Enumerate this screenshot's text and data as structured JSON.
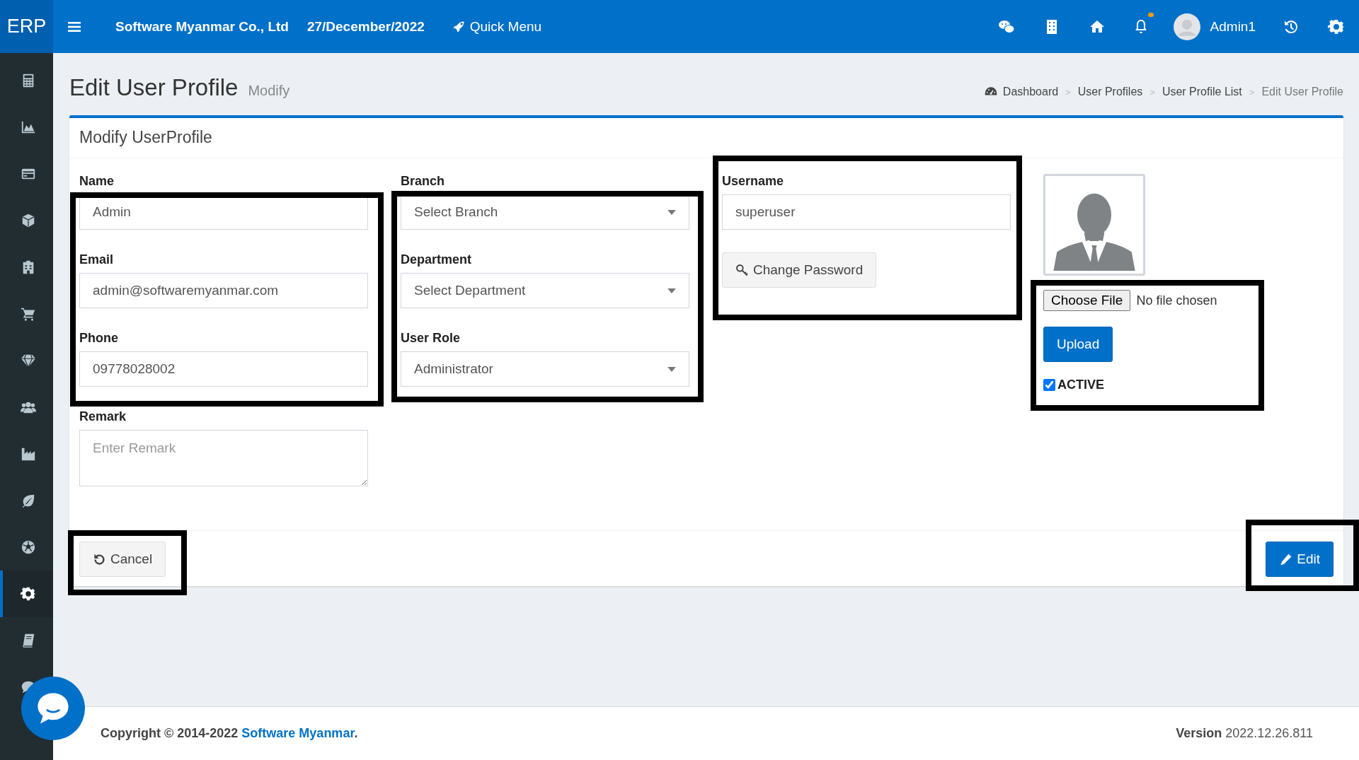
{
  "topbar": {
    "brand": "ERP",
    "company": "Software Myanmar Co., Ltd",
    "date": "27/December/2022",
    "quick_menu": "Quick Menu",
    "has_notification": true,
    "user": "Admin1"
  },
  "sidebar": {
    "items": [
      {
        "selected": false
      },
      {
        "selected": false
      },
      {
        "selected": false
      },
      {
        "selected": false
      },
      {
        "selected": false
      },
      {
        "selected": false
      },
      {
        "selected": false
      },
      {
        "selected": false
      },
      {
        "selected": false
      },
      {
        "selected": false
      },
      {
        "selected": false
      },
      {
        "selected": true
      },
      {
        "selected": false
      },
      {
        "selected": false
      }
    ]
  },
  "page": {
    "title": "Edit User Profile",
    "subtitle": "Modify",
    "breadcrumb_separator": ">",
    "breadcrumb": [
      {
        "label": "Dashboard",
        "current": false
      },
      {
        "label": "User Profiles",
        "current": false
      },
      {
        "label": "User Profile List",
        "current": false
      },
      {
        "label": "Edit User Profile",
        "current": true
      }
    ]
  },
  "card": {
    "title": "Modify UserProfile",
    "columns": [
      {
        "groups": [
          {
            "highlighted": true,
            "fields": [
              {
                "kind": "text",
                "label": "Name",
                "value": "Admin"
              },
              {
                "kind": "text",
                "label": "Email",
                "value": "admin@softwaremyanmar.com"
              },
              {
                "kind": "text",
                "label": "Phone",
                "value": "09778028002"
              }
            ]
          },
          {
            "highlighted": false,
            "fields": [
              {
                "kind": "textarea",
                "label": "Remark",
                "placeholder": "Enter Remark"
              }
            ]
          }
        ]
      },
      {
        "groups": [
          {
            "highlighted": true,
            "fields": [
              {
                "kind": "select",
                "label": "Branch",
                "value": "Select Branch"
              },
              {
                "kind": "select",
                "label": "Department",
                "value": "Select Department"
              },
              {
                "kind": "select",
                "label": "User Role",
                "value": "Administrator"
              }
            ]
          }
        ]
      },
      {
        "groups": [
          {
            "highlighted": true,
            "fields": [
              {
                "kind": "text",
                "label": "Username",
                "value": "superuser"
              },
              {
                "kind": "button",
                "label": "Change Password"
              }
            ]
          }
        ]
      }
    ],
    "photo": {
      "highlighted": true,
      "choose_file": "Choose File",
      "file_status": "No file chosen",
      "upload": "Upload",
      "active_label": "ACTIVE",
      "active": true
    },
    "actions": [
      {
        "kind": "cancel",
        "label": "Cancel",
        "highlighted": true
      },
      {
        "kind": "edit",
        "label": "Edit",
        "highlighted": true
      }
    ]
  },
  "footer": {
    "copyright": "Copyright © 2014-2022",
    "company_link": "Software Myanmar",
    "end": ".",
    "version_label": "Version",
    "version": "2022.12.26.811"
  }
}
